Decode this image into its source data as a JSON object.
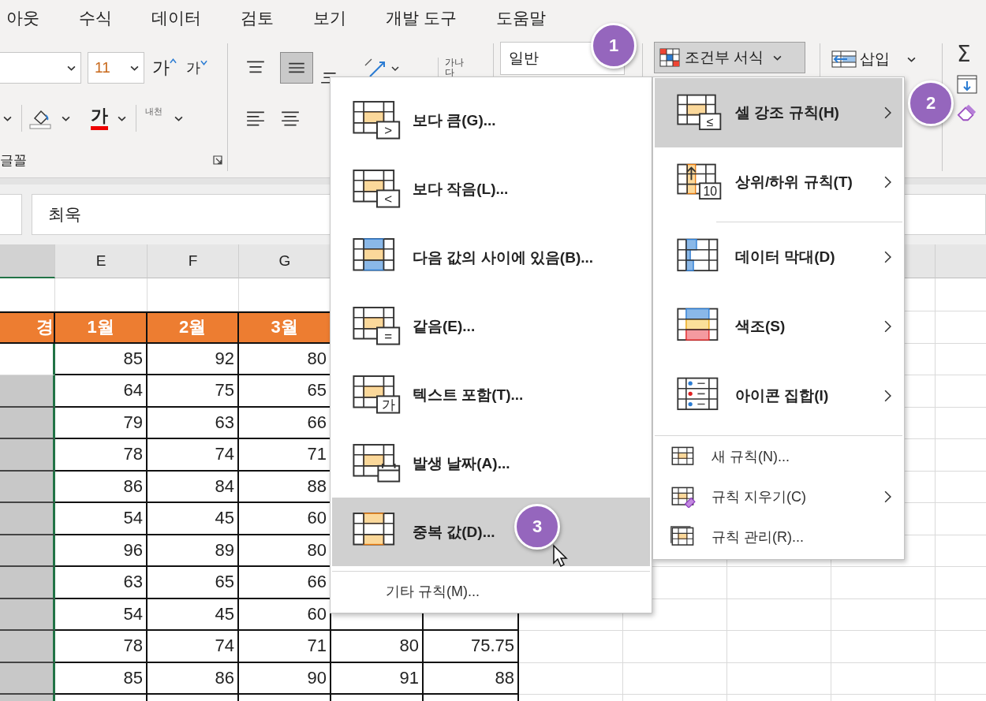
{
  "ribbon_tabs": [
    {
      "label": "아웃"
    },
    {
      "label": "수식"
    },
    {
      "label": "데이터"
    },
    {
      "label": "검토"
    },
    {
      "label": "보기"
    },
    {
      "label": "개발 도구"
    },
    {
      "label": "도움말"
    }
  ],
  "font_group": {
    "font_size": "11",
    "grow_font": "가",
    "shrink_font": "가",
    "font_color": "가",
    "phonetic": "내천",
    "label": "글꼴"
  },
  "alignment_group": {
    "middle_align_selected": true,
    "wrap_text": "가나다"
  },
  "number_group": {
    "format": "일반"
  },
  "styles_group": {
    "conditional_formatting": "조건부 서식",
    "pressed": true
  },
  "cells_group": {
    "insert": "삽입"
  },
  "editing_group": {
    "autosum": "Σ"
  },
  "formula_bar": {
    "value": "최욱"
  },
  "sheet": {
    "column_headers": [
      {
        "selected": true
      },
      {
        "label": "E",
        "selected": false
      },
      {
        "label": "F",
        "selected": false
      },
      {
        "label": "G",
        "selected": false
      }
    ],
    "title_row": [
      "경",
      "1월",
      "2월",
      "3월"
    ],
    "rows": [
      {
        "shaded": false,
        "values": [
          "85",
          "92",
          "80"
        ]
      },
      {
        "shaded": true,
        "values": [
          "64",
          "75",
          "65"
        ]
      },
      {
        "shaded": true,
        "values": [
          "79",
          "63",
          "66"
        ]
      },
      {
        "shaded": true,
        "values": [
          "78",
          "74",
          "71"
        ]
      },
      {
        "shaded": true,
        "values": [
          "86",
          "84",
          "88"
        ]
      },
      {
        "shaded": true,
        "values": [
          "54",
          "45",
          "60"
        ]
      },
      {
        "shaded": true,
        "values": [
          "96",
          "89",
          "80"
        ]
      },
      {
        "shaded": true,
        "values": [
          "63",
          "65",
          "66"
        ]
      },
      {
        "shaded": true,
        "values": [
          "54",
          "45",
          "60"
        ]
      },
      {
        "shaded": true,
        "values": [
          "78",
          "74",
          "71",
          "80",
          "75.75"
        ]
      },
      {
        "shaded": true,
        "values": [
          "85",
          "86",
          "90",
          "91",
          "88"
        ]
      }
    ]
  },
  "highlight_rules_menu": {
    "items": [
      {
        "label": "보다 큼(G)...",
        "badge": ">",
        "selected": false
      },
      {
        "label": "보다 작음(L)...",
        "badge": "<",
        "selected": false
      },
      {
        "label": "다음 값의 사이에 있음(B)...",
        "selected": false
      },
      {
        "label": "같음(E)...",
        "badge": "=",
        "selected": false
      },
      {
        "label": "텍스트 포함(T)...",
        "badge": "가",
        "selected": false
      },
      {
        "label": "발생 날짜(A)...",
        "selected": false
      },
      {
        "label": "중복 값(D)...",
        "selected": true
      }
    ],
    "footer": "기타 규칙(M)..."
  },
  "conditional_menu": {
    "sections": [
      {
        "kind": "large",
        "items": [
          {
            "label": "셀 강조 규칙(H)",
            "badge": "≤",
            "selected": true,
            "submenu": true
          },
          {
            "label": "상위/하위 규칙(T)",
            "badge": "10",
            "selected": false,
            "submenu": true
          }
        ]
      },
      {
        "kind": "large",
        "items": [
          {
            "label": "데이터 막대(D)",
            "selected": false,
            "submenu": true
          },
          {
            "label": "색조(S)",
            "selected": false,
            "submenu": true
          },
          {
            "label": "아이콘 집합(I)",
            "selected": false,
            "submenu": true
          }
        ]
      },
      {
        "kind": "small",
        "items": [
          {
            "label": "새 규칙(N)...",
            "selected": false,
            "submenu": false
          },
          {
            "label": "규칙 지우기(C)",
            "selected": false,
            "submenu": true
          },
          {
            "label": "규칙 관리(R)...",
            "selected": false,
            "submenu": false
          }
        ]
      }
    ]
  },
  "callouts": [
    "1",
    "2",
    "3"
  ]
}
